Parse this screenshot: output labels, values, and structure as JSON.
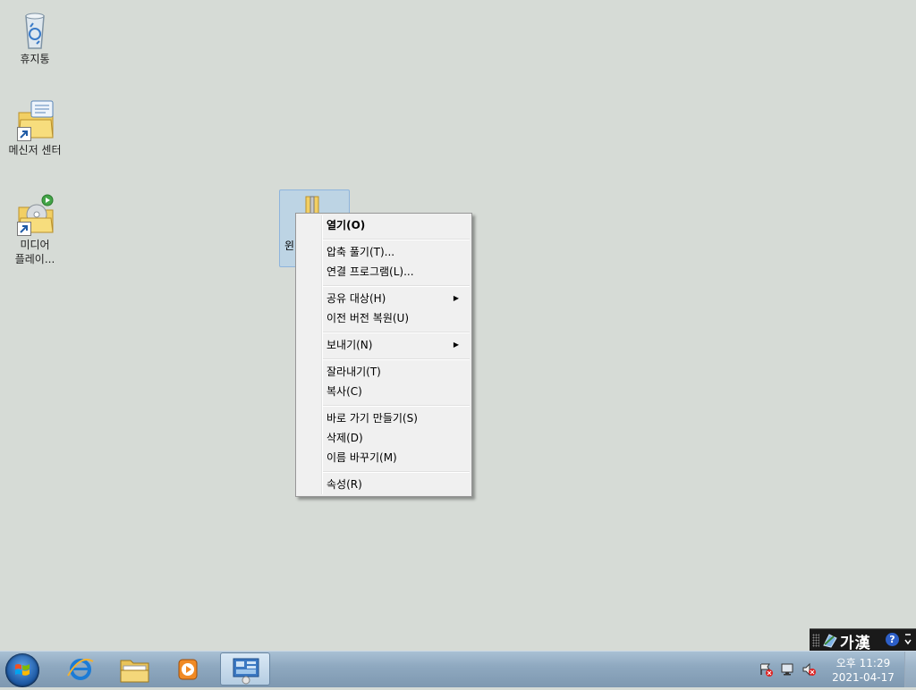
{
  "desktop": {
    "icons": [
      {
        "label": "휴지통"
      },
      {
        "label": "메신저 센터"
      },
      {
        "label": "미디어\n플레이..."
      }
    ],
    "selected_file_label": "윈"
  },
  "context_menu": {
    "items": [
      {
        "label": "열기(O)",
        "bold": true
      },
      {
        "label": "압축 풀기(T)..."
      },
      {
        "label": "연결 프로그램(L)..."
      },
      {
        "label": "공유 대상(H)",
        "submenu": true
      },
      {
        "label": "이전 버전 복원(U)"
      },
      {
        "label": "보내기(N)",
        "submenu": true
      },
      {
        "label": "잘라내기(T)"
      },
      {
        "label": "복사(C)"
      },
      {
        "label": "바로 가기 만들기(S)"
      },
      {
        "label": "삭제(D)"
      },
      {
        "label": "이름 바꾸기(M)"
      },
      {
        "label": "속성(R)"
      }
    ]
  },
  "language_bar": {
    "ime_text": "가漢",
    "help": "?"
  },
  "taskbar": {
    "pinned": [
      "start-orb",
      "internet-explorer-icon",
      "windows-explorer-icon",
      "media-player-icon",
      "control-panel-icon"
    ],
    "tray_icons": [
      "action-center-icon",
      "network-icon",
      "volume-muted-icon"
    ],
    "clock": {
      "time": "오후 11:29",
      "date": "2021-04-17"
    }
  },
  "colors": {
    "desktop_bg": "#d6dbd6",
    "taskbar": "#8fa9c0",
    "menu_bg": "#f0f0f0"
  }
}
